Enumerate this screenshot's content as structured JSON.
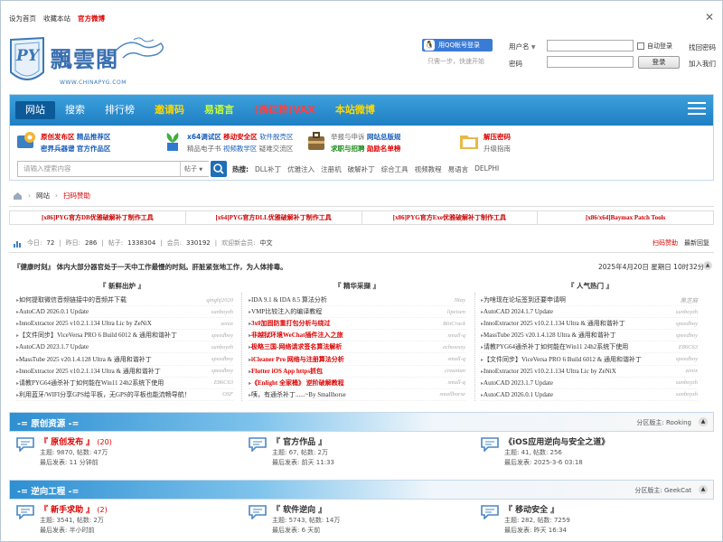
{
  "top": {
    "set_home": "设为首页",
    "bookmark": "收藏本站",
    "weibo": "官方微博"
  },
  "logo": {
    "brand": "飄雲閣",
    "url": "WWW.CHINAPYG.COM",
    "mark": "PY"
  },
  "login": {
    "qq_button": "用QQ帐号登录",
    "qq_tip": "只需一步，快速开始",
    "user_label": "用户名",
    "pass_label": "密码",
    "auto_login": "自动登录",
    "submit": "登录",
    "forgot": "找回密码",
    "join": "加入我们"
  },
  "nav": {
    "items": [
      "网站",
      "搜索",
      "排行榜",
      "邀请码",
      "易语言",
      "(西红柿)VAX",
      "本站微博"
    ]
  },
  "quick": [
    {
      "icon": "gear-icon",
      "r1": [
        "原创发布区",
        "精品推荐区"
      ],
      "r2": [
        "密界兵器谱",
        "官方作品区"
      ]
    },
    {
      "icon": "plant-icon",
      "r1": [
        "x64调试区",
        "移动安全区",
        "软件脱壳区"
      ],
      "r2": [
        "精品电子书",
        "视频教学区",
        "疑难交流区"
      ]
    },
    {
      "icon": "bag-icon",
      "r1": [
        "举报与申诉",
        "网站总版规"
      ],
      "r2": [
        "求职与招聘",
        "勋励名单榜"
      ]
    },
    {
      "icon": "folder-icon",
      "r1": [
        "解压密码"
      ],
      "r2": [
        "升级指南"
      ]
    }
  ],
  "search": {
    "placeholder": "请输入搜索内容",
    "scope": "帖子",
    "hot_label": "热搜:",
    "hot": [
      "DLL补丁",
      "优雅注入",
      "注册机",
      "破解补丁",
      "综合工具",
      "视频教程",
      "易语言",
      "DELPHI"
    ]
  },
  "breadcrumb": {
    "home": "网站",
    "current": "扫码赞助"
  },
  "ads": [
    "[x86]PYG官方DB优雅破解补丁制作工具",
    "[x64]PYG官方DLL优雅破解补丁制作工具",
    "[x86]PYG官方Exe优雅破解补丁制作工具",
    "[x86/x64]Baymax Patch Tools"
  ],
  "stats": {
    "today_label": "今日:",
    "today": "72",
    "yesterday_label": "昨日:",
    "yesterday": "286",
    "posts_label": "帖子:",
    "posts": "1338304",
    "members_label": "会员:",
    "members": "330192",
    "welcome": "欢迎新会员:",
    "newest": "中文",
    "sponsor": "扫码赞助",
    "latest": "最新回复"
  },
  "notice": "『健康时刻』 体内大部分器官处于一天中工作最慢的时刻。肝脏紧张地工作，为人体排毒。",
  "date": "2025年4月20日 星期日 10时32分",
  "columns": {
    "h1": "『 新鲜出炉 』",
    "h2": "『 精华采撷 』",
    "h3": "『 人气热门 』",
    "c1": [
      {
        "t": "如何提取微信音频链接中的音频并下载",
        "a": "qinghj2020"
      },
      {
        "t": "AutoCAD 2026.0.1 Update",
        "a": "sunboyzh"
      },
      {
        "t": "InnoExtractor 2025 v10.2.1.134 Ultra Lic by ZeNiX",
        "a": "zenix"
      },
      {
        "t": "【文件同步】ViceVersa PRO 6 Build 6012 & 通用和谐补丁",
        "a": "speedboy"
      },
      {
        "t": "AutoCAD 2023.1.7 Update",
        "a": "sunboyzh"
      },
      {
        "t": "MassTube 2025 v20.1.4.128 Ultra & 通用和谐补丁",
        "a": "speedboy"
      },
      {
        "t": "InnoExtractor 2025 v10.2.1.134 Ultra & 通用和谐补丁",
        "a": "speedboy"
      },
      {
        "t": "请教PYG64通杀补丁如何能在Win11 24h2系统下使用",
        "a": "E86C63"
      },
      {
        "t": "利用蓝牙/WIFI分享GPS给平板，无GPS的平板也能流畅导航！",
        "a": "OSF"
      }
    ],
    "c2": [
      {
        "t": "IDA 9.1 & IDA 8.5 算法分析",
        "a": "Ntay",
        "red": false
      },
      {
        "t": "VMP比较注入的编译教程",
        "a": "lipeisen",
        "red": false
      },
      {
        "t": "3x0加固防重打包分析与绕过",
        "a": "BinCrack",
        "red": true
      },
      {
        "t": "非越狱环境WeChat插件注入之旅",
        "a": "small-q",
        "red": true
      },
      {
        "t": "极略三国-网络请求签名算法解析",
        "a": "echowxsy",
        "red": true
      },
      {
        "t": "iCleaner Pro 网络与注册算法分析",
        "a": "small-q",
        "red": true
      },
      {
        "t": "Flutter iOS App https抓包",
        "a": "creantan",
        "red": true
      },
      {
        "t": "《Enlight 全家桶》 逆阶破解教程",
        "a": "small-q",
        "red": true
      },
      {
        "t": "咦，有通杀补丁......~By Smallhorse",
        "a": "smallhorse",
        "red": false
      }
    ],
    "c3": [
      {
        "t": "为啥现在论坛签到还要申请啊",
        "a": "黑芝麻"
      },
      {
        "t": "AutoCAD 2024.1.7 Update",
        "a": "sunboyzh"
      },
      {
        "t": "InnoExtractor 2025 v10.2.1.134 Ultra & 通用和谐补丁",
        "a": "speedboy"
      },
      {
        "t": "MassTube 2025 v20.1.4.128 Ultra & 通用和谐补丁",
        "a": "speedboy"
      },
      {
        "t": "请教PYG64通杀补丁如何能在Win11 24h2系统下使用",
        "a": "E86C63"
      },
      {
        "t": "【文件同步】ViceVersa PRO 6 Build 6012 & 通用和谐补丁",
        "a": "speedboy"
      },
      {
        "t": "InnoExtractor 2025 v10.2.1.134 Ultra Lic by ZeNiX",
        "a": "zenix"
      },
      {
        "t": "AutoCAD 2023.1.7 Update",
        "a": "sunboyzh"
      },
      {
        "t": "AutoCAD 2026.0.1 Update",
        "a": "sunboyzh"
      }
    ]
  },
  "sec1": {
    "title": "-= 原创资源 -=",
    "mod": "分区版主: Rooking",
    "forums": [
      {
        "name": "『 原创发布 』",
        "count": "(20)",
        "l1": "主题: 9870, 帖数: 47万",
        "l2": "最后发表: 11 分钟前"
      },
      {
        "name": "『 官方作品 』",
        "count": "",
        "l1": "主题: 67, 帖数: 2万",
        "l2": "最后发表: 前天 11:33"
      },
      {
        "name": "《iOS应用逆向与安全之道》",
        "count": "",
        "l1": "主题: 41, 帖数: 256",
        "l2": "最后发表: 2025-3-6 03:18"
      }
    ]
  },
  "sec2": {
    "title": "-= 逆向工程 -=",
    "mod": "分区版主: GeekCat",
    "forums": [
      {
        "name": "『 新手求助 』",
        "count": "(2)",
        "l1": "主题: 3541, 帖数: 2万",
        "l2": "最后发表: 半小时前"
      },
      {
        "name": "『 软件逆向 』",
        "count": "",
        "l1": "主题: 5743, 帖数: 14万",
        "l2": "最后发表: 6 天前"
      },
      {
        "name": "『 移动安全 』",
        "count": "",
        "l1": "主题: 282, 帖数: 7259",
        "l2": "最后发表: 昨天 16:34"
      }
    ]
  }
}
